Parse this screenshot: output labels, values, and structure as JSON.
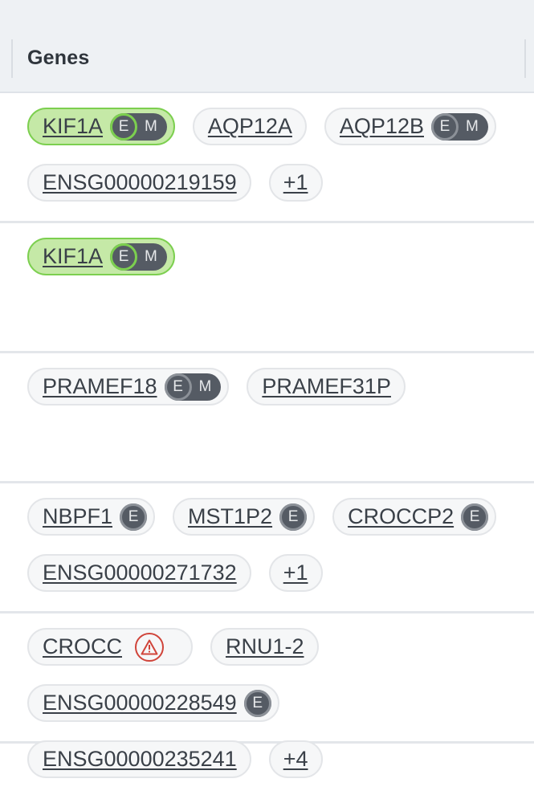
{
  "header": {
    "title": "Genes"
  },
  "rows": [
    {
      "chips": [
        {
          "symbol": "KIF1A",
          "highlight": true,
          "badges": [
            "E",
            "M"
          ]
        },
        {
          "symbol": "AQP12A"
        },
        {
          "symbol": "AQP12B",
          "badges": [
            "E",
            "M"
          ]
        },
        {
          "symbol": "ENSG00000219159"
        },
        {
          "symbol": "+1",
          "more": true
        }
      ]
    },
    {
      "chips": [
        {
          "symbol": "KIF1A",
          "highlight": true,
          "badges": [
            "E",
            "M"
          ]
        }
      ]
    },
    {
      "chips": [
        {
          "symbol": "PRAMEF18",
          "badges": [
            "E",
            "M"
          ]
        },
        {
          "symbol": "PRAMEF31P"
        }
      ]
    },
    {
      "chips": [
        {
          "symbol": "NBPF1",
          "badges": [
            "E"
          ]
        },
        {
          "symbol": "MST1P2",
          "badges": [
            "E"
          ]
        },
        {
          "symbol": "CROCCP2",
          "badges": [
            "E"
          ]
        },
        {
          "symbol": "ENSG00000271732"
        },
        {
          "symbol": "+1",
          "more": true
        }
      ]
    },
    {
      "chips": [
        {
          "symbol": "CROCC",
          "warning": true,
          "icon": "warning-triangle-icon"
        },
        {
          "symbol": "RNU1-2"
        },
        {
          "symbol": "ENSG00000228549",
          "badges": [
            "E"
          ]
        },
        {
          "symbol": "ENSG00000235241"
        },
        {
          "symbol": "+4",
          "more": true
        }
      ]
    }
  ],
  "colors": {
    "highlight_bg": "#c5e9a7",
    "highlight_border": "#7ccf4f",
    "badge_bg": "#555b64",
    "warning": "#d0443a"
  }
}
